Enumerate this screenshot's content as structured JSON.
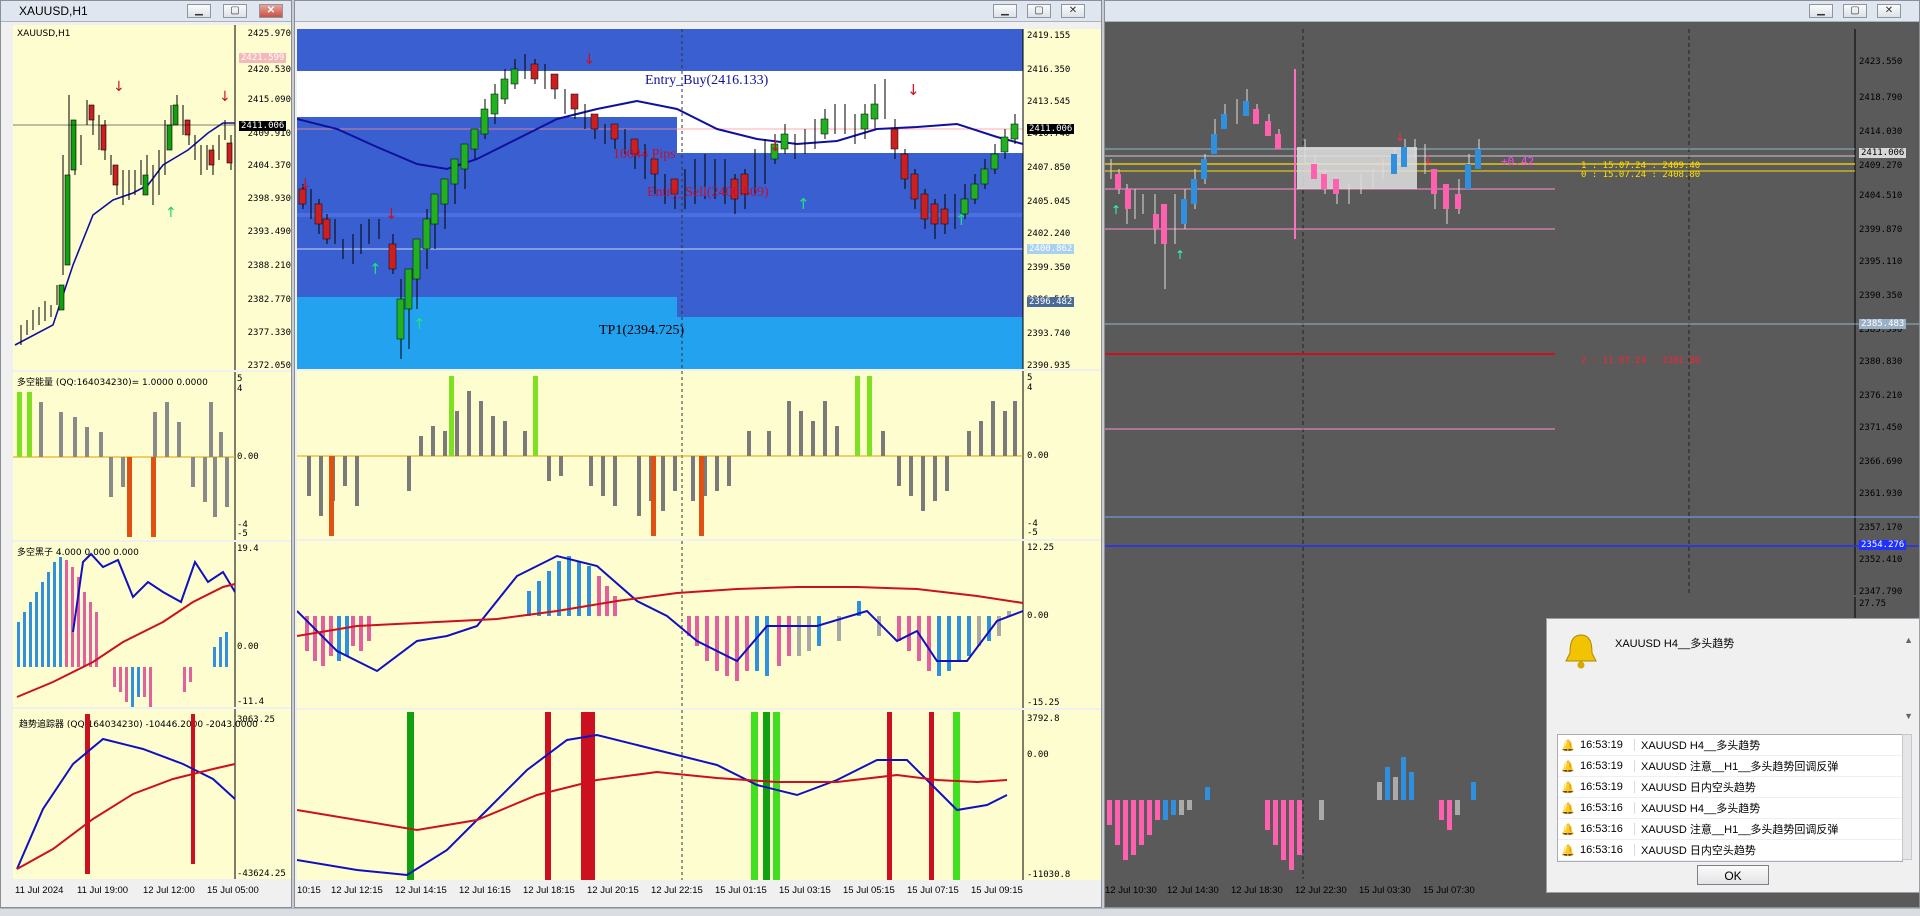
{
  "windows": {
    "left": {
      "title": "XAUUSD,H1",
      "chart_label": "XAUUSD,H1"
    },
    "middle": {
      "title": ""
    },
    "right": {
      "title": ""
    }
  },
  "left_price_scale": [
    "2425.970",
    "2420.530",
    "2415.090",
    "2409.910",
    "2404.370",
    "2398.930",
    "2393.490",
    "2388.210",
    "2382.770",
    "2377.330",
    "2372.050"
  ],
  "left_current_price": "2411.006",
  "left_top_tag": "2421.599",
  "left_ind1": {
    "label": "多空能量 (QQ:164034230)= 1.0000 0.0000",
    "scale": [
      "4",
      "0.00",
      "-4",
      "-5"
    ],
    "top": "5"
  },
  "left_ind2": {
    "label": "多空黑子 4.000 0.000 0.000",
    "scale": [
      "19.4",
      "0.00",
      "-11.4"
    ]
  },
  "left_ind3": {
    "label": "趋势追踪器 (QQ:164034230)  -10446.2000  -2043.0000",
    "scale": [
      "3063.25",
      "-43624.25"
    ]
  },
  "left_time_axis": [
    "11 Jul 2024",
    "11 Jul 19:00",
    "12 Jul 12:00",
    "15 Jul 05:00"
  ],
  "mid_price_scale": [
    "2419.155",
    "2416.350",
    "2413.545",
    "2410.740",
    "2407.850",
    "2405.045",
    "2402.240",
    "2399.350",
    "2396.545",
    "2393.740",
    "2390.935"
  ],
  "mid_current_price": "2411.006",
  "mid_tag2": "2400.862",
  "mid_tag3": "2396.482",
  "mid_annotations": {
    "entry_buy": "Entry_Buy(2416.133)",
    "pips": "10044 Pips",
    "entry_sell": "Entry_Sell(2406.509)",
    "tp1": "TP1(2394.725)"
  },
  "mid_ind1_scale": [
    "5",
    "4",
    "0.00",
    "-4",
    "-5"
  ],
  "mid_ind2_scale": [
    "12.25",
    "0.00",
    "-15.25"
  ],
  "mid_ind3_scale": [
    "3792.8",
    "0.00",
    "-11030.8"
  ],
  "mid_time_axis": [
    "10:15",
    "12 Jul 12:15",
    "12 Jul 14:15",
    "12 Jul 16:15",
    "12 Jul 18:15",
    "12 Jul 20:15",
    "12 Jul 22:15",
    "15 Jul 01:15",
    "15 Jul 03:15",
    "15 Jul 05:15",
    "15 Jul 07:15",
    "15 Jul 09:15"
  ],
  "right_price_scale": [
    "2423.550",
    "2418.790",
    "2414.030",
    "2409.270",
    "2404.510",
    "2399.870",
    "2395.110",
    "2390.350",
    "2385.590",
    "2380.830",
    "2376.210",
    "2371.450",
    "2366.690",
    "2361.930",
    "2357.170",
    "2352.410",
    "2347.790"
  ],
  "right_current_price": "2411.006",
  "right_tag_blue": "2354.276",
  "right_tag_gray": "2385.483",
  "right_lines": {
    "line1": "1 : 15.07.24 : 2409.40",
    "line0": "0 : 15.07.24 : 2408.80",
    "line2": "2 : 11.07.24 : 2381.80",
    "price_note": "+0.42"
  },
  "right_ind_top": "27.75",
  "right_time_axis": [
    "12 Jul 10:30",
    "12 Jul 14:30",
    "12 Jul 18:30",
    "12 Jul 22:30",
    "15 Jul 03:30",
    "15 Jul 07:30"
  ],
  "alert": {
    "headline": "XAUUSD  H4__多头趋势",
    "ok_label": "OK",
    "rows": [
      {
        "time": "16:53:19",
        "msg": "XAUUSD  H4__多头趋势"
      },
      {
        "time": "16:53:19",
        "msg": "XAUUSD  注意__H1__多头趋势回调反弹"
      },
      {
        "time": "16:53:19",
        "msg": "XAUUSD  日内空头趋势"
      },
      {
        "time": "16:53:16",
        "msg": "XAUUSD  H4__多头趋势"
      },
      {
        "time": "16:53:16",
        "msg": "XAUUSD  注意__H1__多头趋势回调反弹"
      },
      {
        "time": "16:53:16",
        "msg": "XAUUSD  日内空头趋势"
      }
    ]
  },
  "colors": {
    "chart_bg": "#fdfdd0",
    "dark_bg": "#5a5a5a",
    "band_blue": "#3a5fd0",
    "band_light": "#23a2f0",
    "ma": "#1010a0",
    "red": "#cc1020",
    "green": "#10b020",
    "bar_gray": "#7a7a7a"
  }
}
